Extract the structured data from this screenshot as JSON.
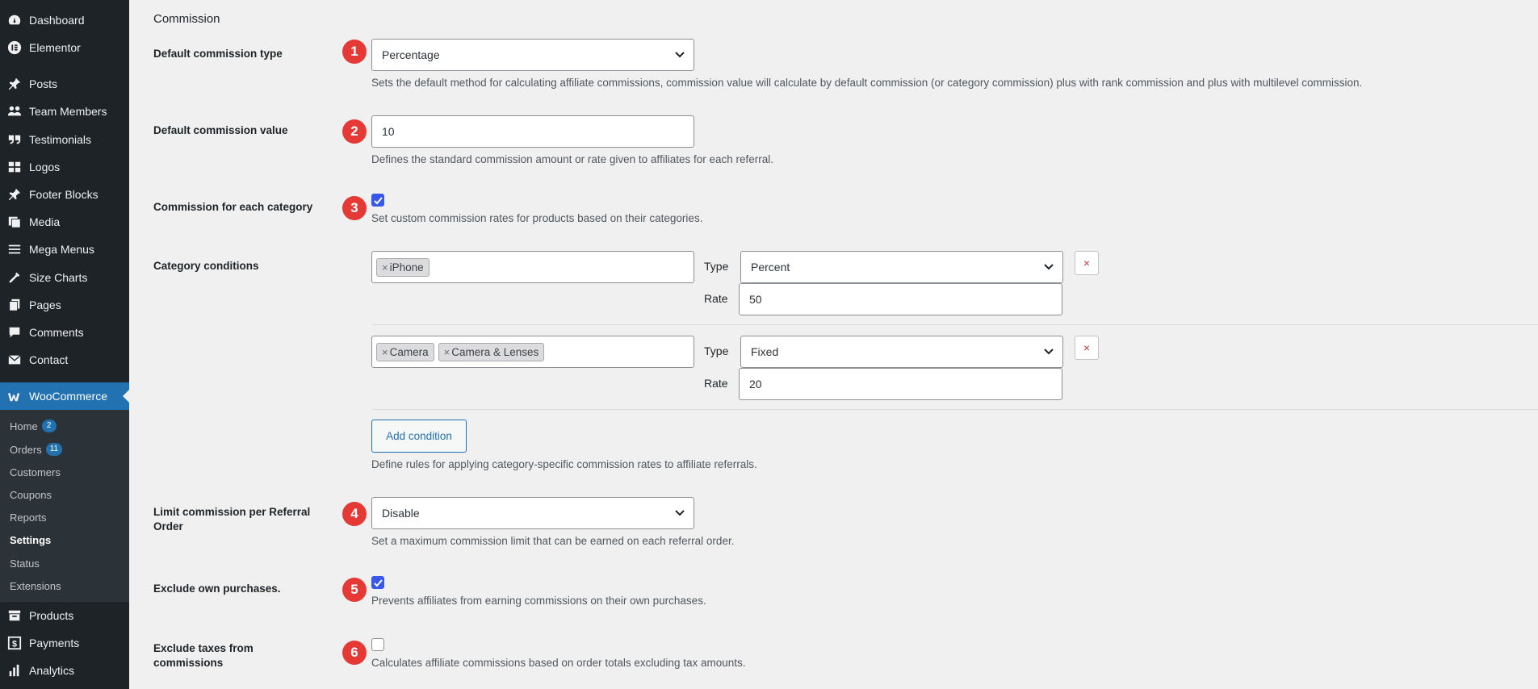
{
  "sidebar": {
    "items": [
      {
        "label": "Dashboard",
        "icon": "dashboard-icon"
      },
      {
        "label": "Elementor",
        "icon": "elementor-icon"
      },
      {
        "label": "Posts",
        "icon": "pin-icon"
      },
      {
        "label": "Team Members",
        "icon": "people-icon"
      },
      {
        "label": "Testimonials",
        "icon": "quote-icon"
      },
      {
        "label": "Logos",
        "icon": "grid-icon"
      },
      {
        "label": "Footer Blocks",
        "icon": "pin-icon"
      },
      {
        "label": "Media",
        "icon": "media-icon"
      },
      {
        "label": "Mega Menus",
        "icon": "menu-icon"
      },
      {
        "label": "Size Charts",
        "icon": "tools-icon"
      },
      {
        "label": "Pages",
        "icon": "pages-icon"
      },
      {
        "label": "Comments",
        "icon": "comment-icon"
      },
      {
        "label": "Contact",
        "icon": "mail-icon"
      }
    ],
    "woocommerce": {
      "label": "WooCommerce",
      "icon": "woo-icon"
    },
    "submenu": [
      {
        "label": "Home",
        "badge": "2"
      },
      {
        "label": "Orders",
        "badge": "11"
      },
      {
        "label": "Customers",
        "badge": ""
      },
      {
        "label": "Coupons",
        "badge": ""
      },
      {
        "label": "Reports",
        "badge": ""
      },
      {
        "label": "Settings",
        "badge": ""
      },
      {
        "label": "Status",
        "badge": ""
      },
      {
        "label": "Extensions",
        "badge": ""
      }
    ],
    "bottom": [
      {
        "label": "Products",
        "icon": "archive-icon"
      },
      {
        "label": "Payments",
        "icon": "dollar-icon"
      },
      {
        "label": "Analytics",
        "icon": "chart-icon"
      }
    ]
  },
  "main": {
    "section_title": "Commission",
    "default_type": {
      "number": "1",
      "label": "Default commission type",
      "value": "Percentage",
      "desc": "Sets the default method for calculating affiliate commissions, commission value will calculate by default commission (or category commission) plus with rank commission and plus with multilevel commission."
    },
    "default_value": {
      "number": "2",
      "label": "Default commission value",
      "value": "10",
      "desc": "Defines the standard commission amount or rate given to affiliates for each referral."
    },
    "per_category": {
      "number": "3",
      "label": "Commission for each category",
      "checked": true,
      "desc": "Set custom commission rates for products based on their categories."
    },
    "category_conditions": {
      "label": "Category conditions",
      "type_label": "Type",
      "rate_label": "Rate",
      "remove_symbol": "×",
      "tag_remove_symbol": "×",
      "rows": [
        {
          "tags": [
            "iPhone"
          ],
          "type": "Percent",
          "rate": "50"
        },
        {
          "tags": [
            "Camera",
            "Camera & Lenses"
          ],
          "type": "Fixed",
          "rate": "20"
        }
      ],
      "add_button": "Add condition",
      "desc": "Define rules for applying category-specific commission rates to affiliate referrals."
    },
    "limit": {
      "number": "4",
      "label": "Limit commission per Referral Order",
      "value": "Disable",
      "desc": "Set a maximum commission limit that can be earned on each referral order."
    },
    "exclude_own": {
      "number": "5",
      "label": "Exclude own purchases.",
      "checked": true,
      "desc": "Prevents affiliates from earning commissions on their own purchases."
    },
    "exclude_taxes": {
      "number": "6",
      "label": "Exclude taxes from commissions",
      "checked": false,
      "desc": "Calculates affiliate commissions based on order totals excluding tax amounts."
    }
  }
}
